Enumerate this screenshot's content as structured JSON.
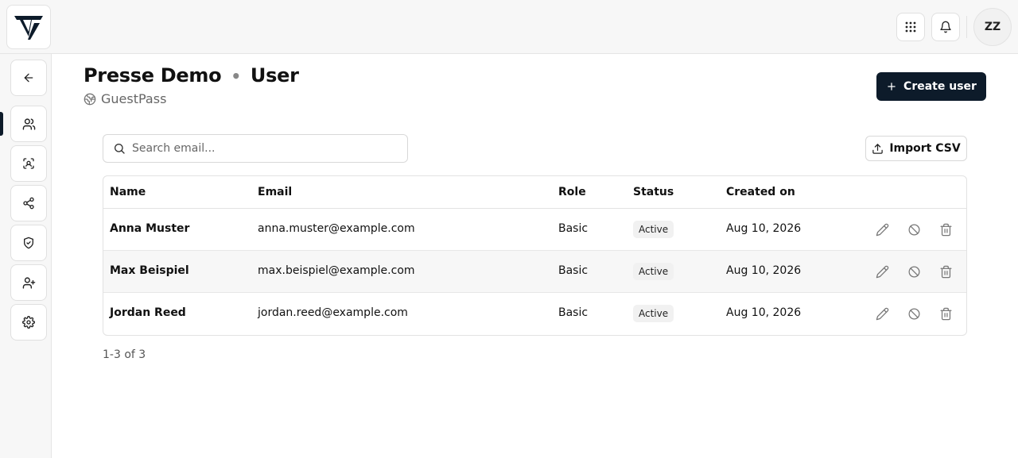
{
  "header": {
    "avatar_initials": "ZZ",
    "apps_icon": "grid-icon",
    "notifications_icon": "bell-icon"
  },
  "sidebar": {
    "items": [
      {
        "icon": "arrow-left-icon",
        "name": "back"
      },
      {
        "icon": "users-icon",
        "name": "users",
        "active": true
      },
      {
        "icon": "scan-face-icon",
        "name": "scan"
      },
      {
        "icon": "share-icon",
        "name": "share"
      },
      {
        "icon": "shield-check-icon",
        "name": "security"
      },
      {
        "icon": "user-plus-icon",
        "name": "invite"
      },
      {
        "icon": "gear-icon",
        "name": "settings"
      }
    ]
  },
  "page": {
    "title_main": "Presse Demo",
    "title_separator": "•",
    "title_section": "User",
    "subtitle": "GuestPass",
    "create_button": "Create user",
    "search_placeholder": "Search email...",
    "import_button": "Import CSV",
    "pagination": "1-3 of 3"
  },
  "table": {
    "columns": [
      "Name",
      "Email",
      "Role",
      "Status",
      "Created on"
    ],
    "rows": [
      {
        "name": "Anna Muster",
        "email": "anna.muster@example.com",
        "role": "Basic",
        "status": "Active",
        "created": "Aug 10, 2026"
      },
      {
        "name": "Max Beispiel",
        "email": "max.beispiel@example.com",
        "role": "Basic",
        "status": "Active",
        "created": "Aug 10, 2026"
      },
      {
        "name": "Jordan Reed",
        "email": "jordan.reed@example.com",
        "role": "Basic",
        "status": "Active",
        "created": "Aug 10, 2026"
      }
    ]
  },
  "colors": {
    "primary": "#0d1b2a",
    "badge_bg": "#f1f1f1",
    "stripe": "#f7f7f7"
  }
}
